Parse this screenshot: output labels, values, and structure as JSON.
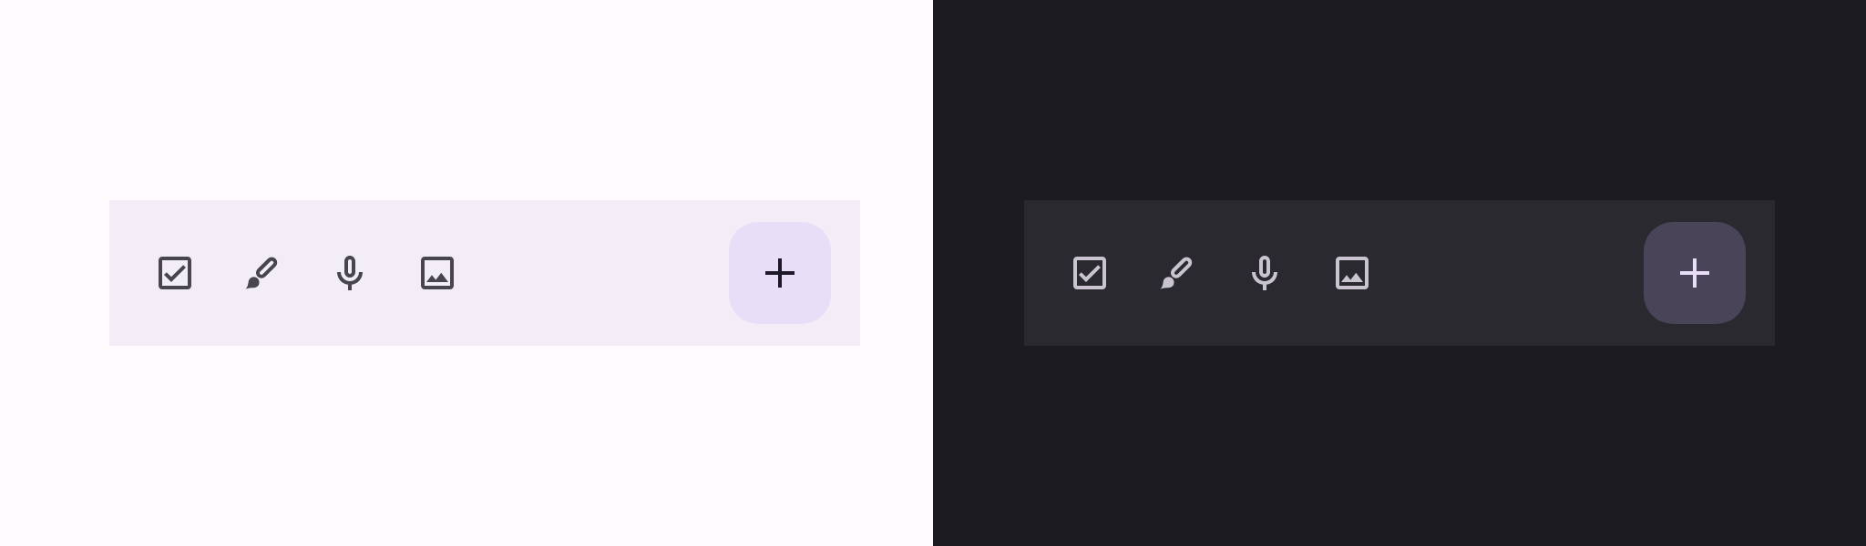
{
  "screens": [
    {
      "kind": "light"
    },
    {
      "kind": "dark"
    }
  ]
}
